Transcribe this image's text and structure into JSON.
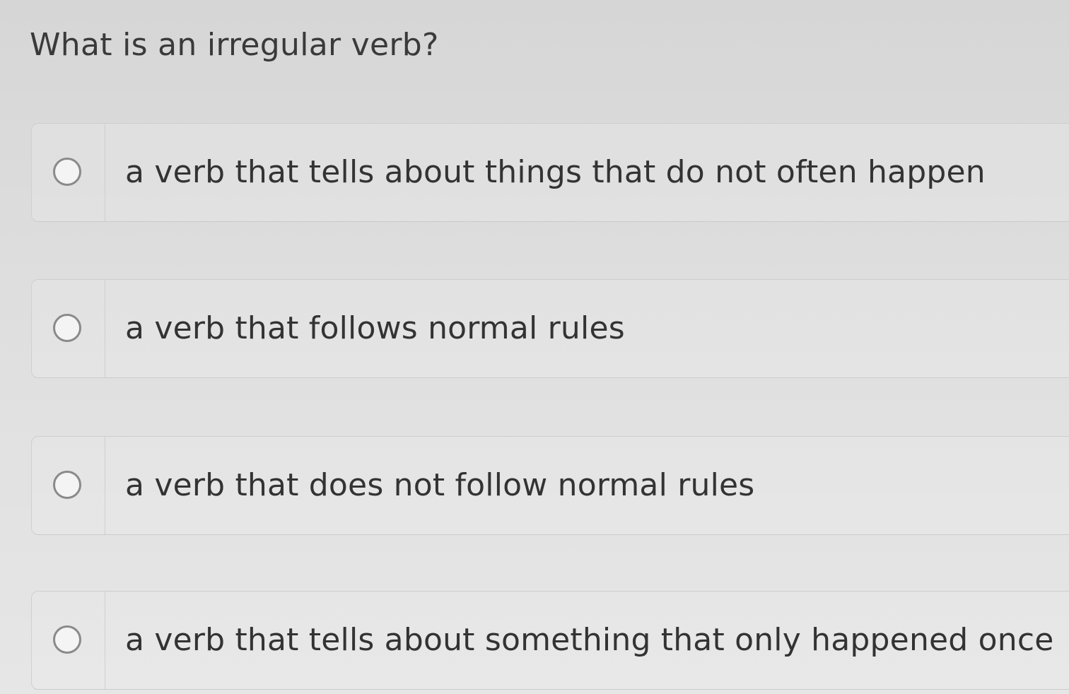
{
  "question": {
    "text": "What is an irregular verb?"
  },
  "options": [
    {
      "label": "a verb that tells about things that do not often happen",
      "selected": false,
      "icon": "radio-button-icon"
    },
    {
      "label": "a verb that follows normal rules",
      "selected": false,
      "icon": "radio-button-icon"
    },
    {
      "label": "a verb that does not follow normal rules",
      "selected": false,
      "icon": "radio-button-icon"
    },
    {
      "label": "a verb that tells about something that only happened once",
      "selected": false,
      "icon": "radio-button-icon"
    }
  ],
  "colors": {
    "background": "#dcdcdc",
    "text": "#333333",
    "radio_border": "#8a8a8a",
    "option_border": "#cdcdcd"
  }
}
